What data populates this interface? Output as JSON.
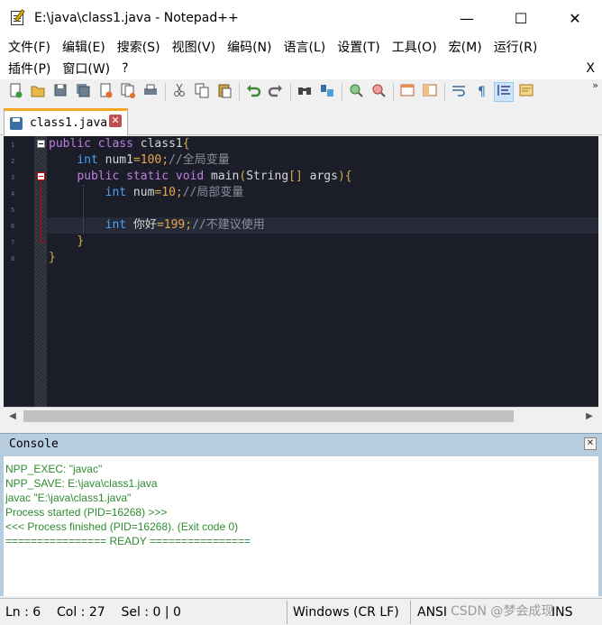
{
  "window": {
    "title": "E:\\java\\class1.java - Notepad++",
    "minimize_glyph": "—",
    "maximize_glyph": "☐",
    "close_glyph": "✕"
  },
  "menu": {
    "row1": [
      "文件(F)",
      "编辑(E)",
      "搜索(S)",
      "视图(V)",
      "编码(N)",
      "语言(L)",
      "设置(T)",
      "工具(O)",
      "宏(M)",
      "运行(R)"
    ],
    "row2": [
      "插件(P)",
      "窗口(W)",
      "?"
    ],
    "close_label": "X"
  },
  "toolbar": {
    "icons": [
      "new-file-icon",
      "open-file-icon",
      "save-icon",
      "save-all-icon",
      "close-icon",
      "close-all-icon",
      "print-icon",
      "cut-icon",
      "copy-icon",
      "paste-icon",
      "undo-icon",
      "redo-icon",
      "find-icon",
      "replace-icon",
      "zoom-in-icon",
      "zoom-out-icon",
      "sync-vertical-icon",
      "sync-horizontal-icon",
      "word-wrap-icon",
      "show-all-chars-icon",
      "indent-guide-icon",
      "document-map-icon"
    ],
    "more_glyph": "»"
  },
  "tab": {
    "label": "class1.java",
    "close_glyph": "✕"
  },
  "editor": {
    "line_numbers": [
      "1",
      "2",
      "3",
      "4",
      "5",
      "6",
      "7",
      "8"
    ],
    "lines": [
      [
        [
          "kw",
          "public"
        ],
        [
          "txt",
          " "
        ],
        [
          "kw",
          "class"
        ],
        [
          "txt",
          " class1"
        ],
        [
          "op",
          "{"
        ]
      ],
      [
        [
          "txt",
          "    "
        ],
        [
          "ty",
          "int"
        ],
        [
          "txt",
          " num1"
        ],
        [
          "op",
          "="
        ],
        [
          "num",
          "100"
        ],
        [
          "op",
          ";"
        ],
        [
          "cm",
          "//全局变量"
        ]
      ],
      [
        [
          "txt",
          "    "
        ],
        [
          "kw",
          "public"
        ],
        [
          "txt",
          " "
        ],
        [
          "kw",
          "static"
        ],
        [
          "txt",
          " "
        ],
        [
          "kw",
          "void"
        ],
        [
          "txt",
          " main"
        ],
        [
          "op",
          "("
        ],
        [
          "txt",
          "String"
        ],
        [
          "op",
          "[]"
        ],
        [
          "txt",
          " args"
        ],
        [
          "op",
          "){"
        ]
      ],
      [
        [
          "txt",
          "        "
        ],
        [
          "ty",
          "int"
        ],
        [
          "txt",
          " num"
        ],
        [
          "op",
          "="
        ],
        [
          "num",
          "10"
        ],
        [
          "op",
          ";"
        ],
        [
          "cm",
          "//局部变量"
        ]
      ],
      [],
      [
        [
          "txt",
          "        "
        ],
        [
          "ty",
          "int"
        ],
        [
          "txt",
          " 你好"
        ],
        [
          "op",
          "="
        ],
        [
          "num",
          "199"
        ],
        [
          "op",
          ";"
        ],
        [
          "cm",
          "//不建议使用"
        ]
      ],
      [
        [
          "txt",
          "    "
        ],
        [
          "op",
          "}"
        ]
      ],
      [
        [
          "op",
          "}"
        ]
      ]
    ]
  },
  "console": {
    "title": "Console",
    "close_glyph": "✕",
    "lines": [
      "NPP_EXEC: \"javac\"",
      "NPP_SAVE: E:\\java\\class1.java",
      "javac \"E:\\java\\class1.java\"",
      "Process started (PID=16268) >>>",
      "<<< Process finished (PID=16268). (Exit code 0)",
      "================ READY ================"
    ]
  },
  "status": {
    "position": "Ln : 6    Col : 27    Sel : 0 | 0",
    "eol": "Windows (CR LF)",
    "encoding": "ANSI",
    "mode": "INS"
  },
  "watermark": "CSDN @梦会成现"
}
